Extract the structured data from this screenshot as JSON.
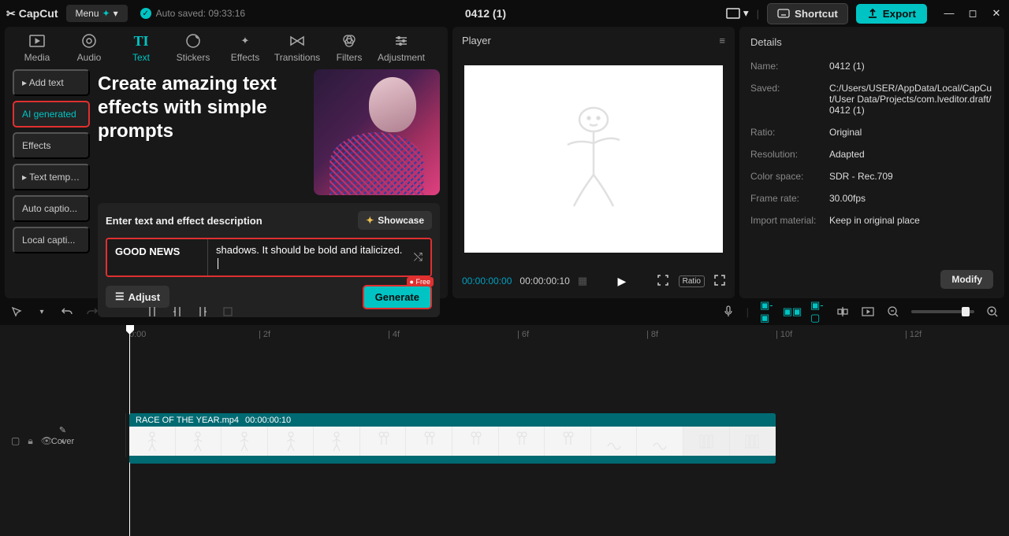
{
  "titlebar": {
    "app_name": "CapCut",
    "menu_label": "Menu",
    "autosave_label": "Auto saved: 09:33:16",
    "project_title": "0412 (1)",
    "shortcut_label": "Shortcut",
    "export_label": "Export"
  },
  "tabs": {
    "media": "Media",
    "audio": "Audio",
    "text": "Text",
    "stickers": "Stickers",
    "effects": "Effects",
    "transitions": "Transitions",
    "filters": "Filters",
    "adjustment": "Adjustment"
  },
  "sidebar": {
    "items": [
      "Add text",
      "AI generated",
      "Effects",
      "Text template",
      "Auto captio...",
      "Local capti..."
    ]
  },
  "ai_panel": {
    "heading": "Create amazing text effects with simple prompts",
    "prompt_title": "Enter text and effect description",
    "showcase_label": "Showcase",
    "input_text": "GOOD NEWS",
    "input_desc": "shadows. It should be bold and italicized. ",
    "adjust_label": "Adjust",
    "generate_label": "Generate",
    "free_badge": "Free"
  },
  "player": {
    "title": "Player",
    "time_current": "00:00:00:00",
    "time_duration": "00:00:00:10",
    "ratio_label": "Ratio"
  },
  "details": {
    "title": "Details",
    "rows": {
      "name_label": "Name:",
      "name_val": "0412 (1)",
      "saved_label": "Saved:",
      "saved_val": "C:/Users/USER/AppData/Local/CapCut/User Data/Projects/com.lveditor.draft/0412 (1)",
      "ratio_label": "Ratio:",
      "ratio_val": "Original",
      "resolution_label": "Resolution:",
      "resolution_val": "Adapted",
      "colorspace_label": "Color space:",
      "colorspace_val": "SDR - Rec.709",
      "framerate_label": "Frame rate:",
      "framerate_val": "30.00fps",
      "import_label": "Import material:",
      "import_val": "Keep in original place"
    },
    "modify_label": "Modify"
  },
  "timeline": {
    "ruler": [
      "0:00",
      "| 2f",
      "| 4f",
      "| 6f",
      "| 8f",
      "| 10f",
      "| 12f"
    ],
    "cover_label": "Cover",
    "clip_name": "RACE OF THE YEAR.mp4",
    "clip_duration": "00:00:00:10"
  }
}
